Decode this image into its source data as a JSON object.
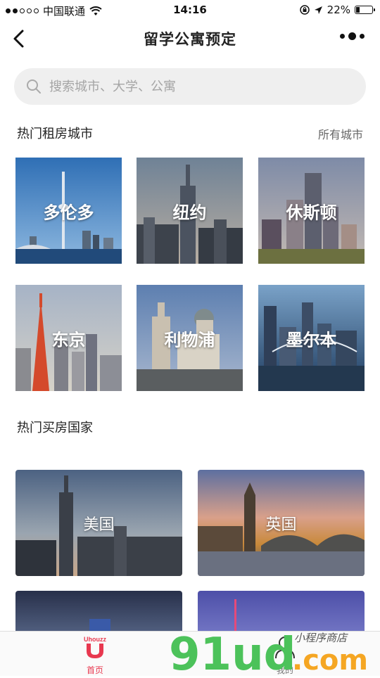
{
  "status_bar": {
    "carrier": "中国联通",
    "time": "14:16",
    "battery": "22%"
  },
  "nav": {
    "title": "留学公寓预定"
  },
  "search": {
    "placeholder": "搜索城市、大学、公寓"
  },
  "rent_section": {
    "title": "热门租房城市",
    "link": "所有城市",
    "cities": [
      {
        "name": "多伦多"
      },
      {
        "name": "纽约"
      },
      {
        "name": "休斯顿"
      },
      {
        "name": "东京"
      },
      {
        "name": "利物浦"
      },
      {
        "name": "墨尔本"
      }
    ]
  },
  "buy_section": {
    "title": "热门买房国家",
    "countries": [
      {
        "name": "美国"
      },
      {
        "name": "英国"
      },
      {
        "name": ""
      },
      {
        "name": ""
      }
    ]
  },
  "tabbar": {
    "home_label": "首页",
    "logo_text": "Uhouzz",
    "mine_label": "我的"
  },
  "watermark": {
    "brand": "91ud",
    "tld": ".com",
    "tagline": "小程序商店"
  },
  "colors": {
    "accent": "#e8384f"
  }
}
